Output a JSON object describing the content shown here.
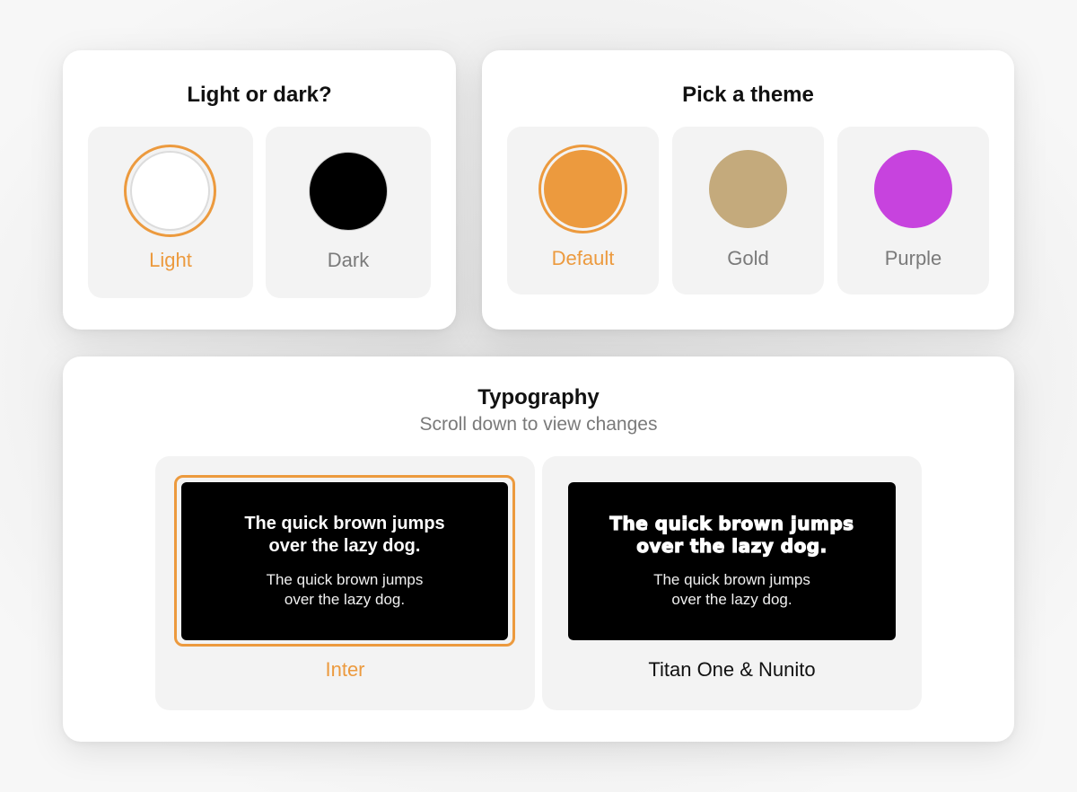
{
  "mode_card": {
    "title": "Light or dark?",
    "options": [
      {
        "label": "Light",
        "color": "#ffffff",
        "selected": true
      },
      {
        "label": "Dark",
        "color": "#000000",
        "selected": false
      }
    ]
  },
  "theme_card": {
    "title": "Pick a theme",
    "options": [
      {
        "label": "Default",
        "color": "#ec9a3e",
        "selected": true
      },
      {
        "label": "Gold",
        "color": "#c4aa7c",
        "selected": false
      },
      {
        "label": "Purple",
        "color": "#c743de",
        "selected": false
      }
    ]
  },
  "typography_card": {
    "title": "Typography",
    "subtitle": "Scroll down to view changes",
    "options": [
      {
        "label": "Inter",
        "selected": true,
        "heading_line1": "The quick brown jumps",
        "heading_line2": "over the lazy dog.",
        "body_line1": "The quick brown jumps",
        "body_line2": "over the lazy dog."
      },
      {
        "label": "Titan One & Nunito",
        "selected": false,
        "heading_line1": "The quick brown jumps",
        "heading_line2": "over the lazy dog.",
        "body_line1": "The quick brown jumps",
        "body_line2": "over the lazy dog."
      }
    ]
  },
  "colors": {
    "accent": "#ec9a3e",
    "tile_background": "#f3f3f3",
    "muted_text": "#7a7a7a"
  }
}
